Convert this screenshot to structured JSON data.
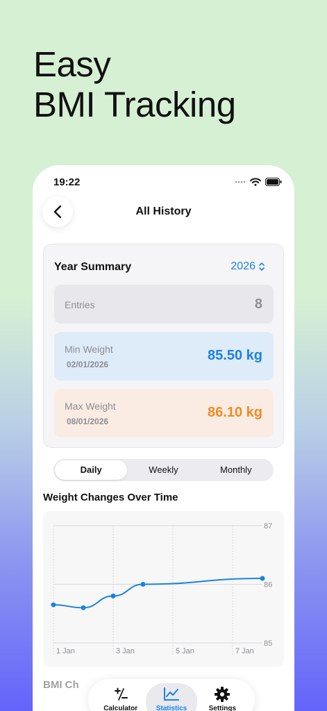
{
  "headline": {
    "line1": "Easy",
    "line2": "BMI Tracking"
  },
  "status_bar": {
    "time": "19:22"
  },
  "nav": {
    "title": "All History"
  },
  "summary": {
    "title": "Year Summary",
    "year": "2026",
    "entries": {
      "label": "Entries",
      "value": "8"
    },
    "min_weight": {
      "label": "Min Weight",
      "date": "02/01/2026",
      "value": "85.50 kg"
    },
    "max_weight": {
      "label": "Max Weight",
      "date": "08/01/2026",
      "value": "86.10 kg"
    }
  },
  "segments": {
    "daily": "Daily",
    "weekly": "Weekly",
    "monthly": "Monthly",
    "selected": "Daily"
  },
  "weight_section": {
    "title": "Weight Changes Over Time"
  },
  "chart_data": {
    "type": "line",
    "x": [
      "1 Jan",
      "2 Jan",
      "3 Jan",
      "4 Jan",
      "8 Jan"
    ],
    "x_ticks": [
      "1 Jan",
      "3 Jan",
      "5 Jan",
      "7 Jan"
    ],
    "series": [
      {
        "values": [
          85.65,
          85.6,
          85.8,
          86.0,
          86.1
        ]
      }
    ],
    "ylim": [
      85,
      87
    ],
    "y_ticks": [
      "85",
      "86",
      "87"
    ],
    "grid": true,
    "color": "#1a82e2"
  },
  "bmi_section": {
    "title": "BMI Ch"
  },
  "tabs": {
    "calculator": "Calculator",
    "statistics": "Statistics",
    "settings": "Settings",
    "active": "Statistics"
  },
  "colors": {
    "accent": "#1a82e2",
    "min_value": "#1a82e2",
    "max_value": "#f08a24"
  }
}
